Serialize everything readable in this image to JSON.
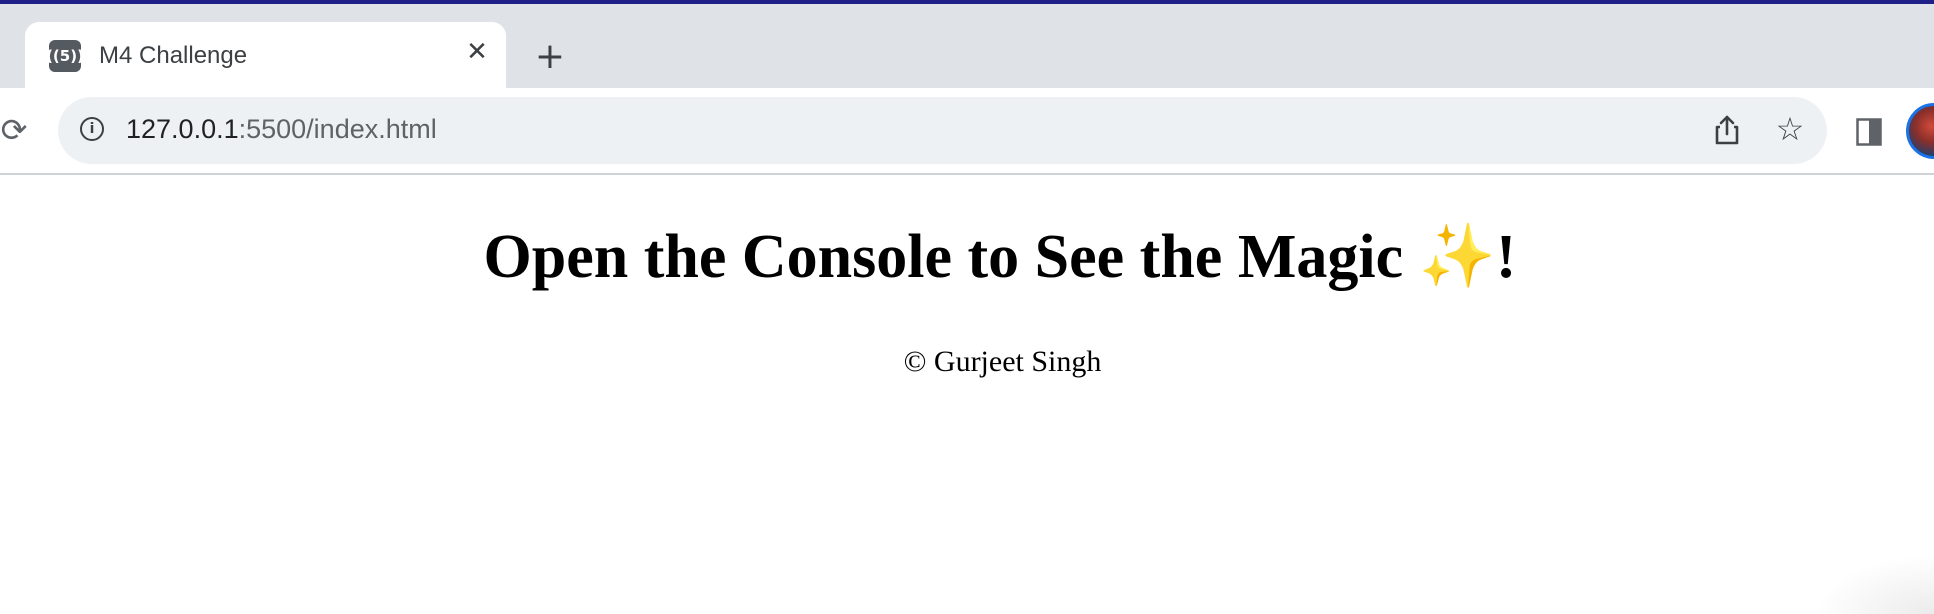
{
  "browser": {
    "tab": {
      "title": "M4 Challenge",
      "favicon_text": "((5))",
      "close_glyph": "✕"
    },
    "new_tab_glyph": "+",
    "reload_glyph": "⟳",
    "address_bar": {
      "host": "127.0.0.1",
      "rest": ":5500/index.html",
      "info_glyph": "i"
    },
    "star_glyph": "☆",
    "accent_color": "#1f1f8a"
  },
  "page": {
    "heading_text": "Open the Console to See the Magic ",
    "heading_sparkle": "✨",
    "heading_end": "!",
    "footer": "© Gurjeet Singh"
  },
  "icons": {
    "favicon": "broadcast-icon",
    "close": "close-icon",
    "new_tab": "plus-icon",
    "reload": "reload-icon",
    "info": "info-icon",
    "share": "share-icon",
    "bookmark": "star-icon",
    "side_panel": "side-panel-icon",
    "avatar": "profile-avatar"
  }
}
